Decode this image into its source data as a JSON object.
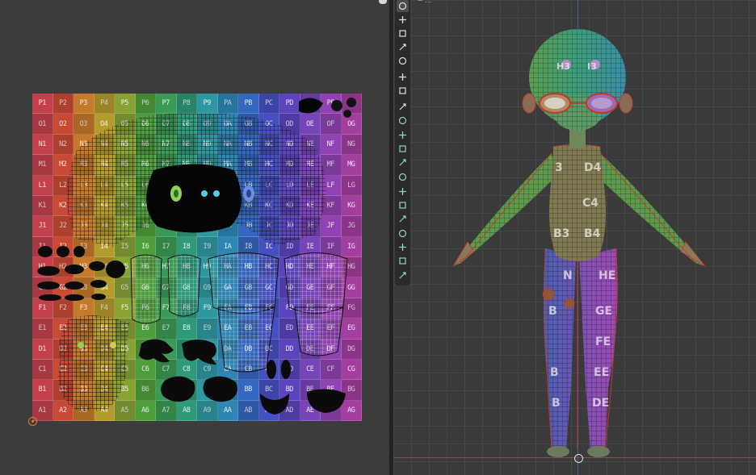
{
  "viewport": {
    "title": "~ …"
  },
  "uv_grid": {
    "rows": [
      [
        "P1",
        "P2",
        "P3",
        "P4",
        "P5",
        "P6",
        "P7",
        "P8",
        "P9",
        "PA",
        "PB",
        "PC",
        "PD",
        "PE",
        "PF",
        "PG"
      ],
      [
        "O1",
        "O2",
        "O3",
        "O4",
        "O5",
        "O6",
        "O7",
        "O8",
        "O9",
        "OA",
        "OB",
        "OC",
        "OD",
        "OE",
        "OF",
        "OG"
      ],
      [
        "N1",
        "N2",
        "N3",
        "N4",
        "N5",
        "N6",
        "N7",
        "N8",
        "N9",
        "NA",
        "NB",
        "NC",
        "ND",
        "NE",
        "NF",
        "NG"
      ],
      [
        "M1",
        "M2",
        "M3",
        "M4",
        "M5",
        "M6",
        "M7",
        "M8",
        "M9",
        "MA",
        "MB",
        "MC",
        "MD",
        "ME",
        "MF",
        "MG"
      ],
      [
        "L1",
        "L2",
        "L3",
        "L4",
        "L5",
        "L6",
        "L7",
        "L8",
        "L9",
        "LA",
        "LB",
        "LC",
        "LD",
        "LE",
        "LF",
        "LG"
      ],
      [
        "K1",
        "K2",
        "K3",
        "K4",
        "K5",
        "K6",
        "K7",
        "K8",
        "K9",
        "KA",
        "KB",
        "KC",
        "KD",
        "KE",
        "KF",
        "KG"
      ],
      [
        "J1",
        "J2",
        "J3",
        "J4",
        "J5",
        "J6",
        "J7",
        "J8",
        "J9",
        "JA",
        "JB",
        "JC",
        "JD",
        "JE",
        "JF",
        "JG"
      ],
      [
        "I1",
        "I2",
        "I3",
        "I4",
        "I5",
        "I6",
        "I7",
        "I8",
        "I9",
        "IA",
        "IB",
        "IC",
        "ID",
        "IE",
        "IF",
        "IG"
      ],
      [
        "H1",
        "H2",
        "H3",
        "H4",
        "H5",
        "H6",
        "H7",
        "H8",
        "H9",
        "HA",
        "HB",
        "HC",
        "HD",
        "HE",
        "HF",
        "HG"
      ],
      [
        "G1",
        "G2",
        "G3",
        "G4",
        "G5",
        "G6",
        "G7",
        "G8",
        "G9",
        "GA",
        "GB",
        "GC",
        "GD",
        "GE",
        "GF",
        "GG"
      ],
      [
        "F1",
        "F2",
        "F3",
        "F4",
        "F5",
        "F6",
        "F7",
        "F8",
        "F9",
        "FA",
        "FB",
        "FC",
        "FD",
        "FE",
        "FF",
        "FG"
      ],
      [
        "E1",
        "E2",
        "E3",
        "E4",
        "E5",
        "E6",
        "E7",
        "E8",
        "E9",
        "EA",
        "EB",
        "EC",
        "ED",
        "EE",
        "EF",
        "EG"
      ],
      [
        "D1",
        "D2",
        "D3",
        "D4",
        "D5",
        "D6",
        "D7",
        "D8",
        "D9",
        "DA",
        "DB",
        "DC",
        "DD",
        "DE",
        "DF",
        "DG"
      ],
      [
        "C1",
        "C2",
        "C3",
        "C4",
        "C5",
        "C6",
        "C7",
        "C8",
        "C9",
        "CA",
        "CB",
        "CC",
        "CD",
        "CE",
        "CF",
        "CG"
      ],
      [
        "B1",
        "B2",
        "B3",
        "B4",
        "B5",
        "B6",
        "B7",
        "B8",
        "B9",
        "BA",
        "BB",
        "BC",
        "BD",
        "BE",
        "BF",
        "BG"
      ],
      [
        "A1",
        "A2",
        "A3",
        "A4",
        "A5",
        "A6",
        "A7",
        "A8",
        "A9",
        "AA",
        "AB",
        "AC",
        "AD",
        "AE",
        "AF",
        "AG"
      ]
    ],
    "column_colors": [
      "#c2404c",
      "#c84a34",
      "#c47a2a",
      "#b59a2c",
      "#86a334",
      "#4f9e3c",
      "#3b9a55",
      "#2f9a7a",
      "#2e98a0",
      "#2f86b4",
      "#3467c0",
      "#4650c2",
      "#5c44bc",
      "#7844b8",
      "#9142b2",
      "#a33e9e"
    ]
  },
  "model_labels": {
    "head_left": "H3",
    "head_right": "I3",
    "torso_top_left": "3",
    "torso_top_right": "D4",
    "torso_mid": "C4",
    "torso_low_left": "B3",
    "torso_low_right": "B4",
    "leg_left_top": "N",
    "leg_right_top": "HE",
    "leg_left_2": "B",
    "leg_right_2": "GE",
    "leg_right_3": "FE",
    "leg_left_4": "B",
    "leg_right_4": "EE",
    "leg_left_5": "B",
    "leg_right_5": "DE"
  },
  "toolbar": {
    "tools": [
      {
        "name": "select-tool-icon"
      },
      {
        "name": "cursor-tool-icon"
      },
      {
        "name": "move-tool-icon"
      },
      {
        "name": "rotate-tool-icon"
      },
      {
        "name": "scale-tool-icon"
      },
      {
        "name": "transform-tool-icon"
      },
      {
        "name": "annotate-tool-icon"
      },
      {
        "name": "measure-tool-icon"
      },
      {
        "name": "add-cube-tool-icon"
      },
      {
        "name": "extrude-tool-icon"
      },
      {
        "name": "inset-tool-icon"
      },
      {
        "name": "bevel-tool-icon"
      },
      {
        "name": "loop-cut-tool-icon"
      },
      {
        "name": "knife-tool-icon"
      },
      {
        "name": "poly-build-tool-icon"
      },
      {
        "name": "spin-tool-icon"
      },
      {
        "name": "smooth-tool-icon"
      },
      {
        "name": "edge-slide-tool-icon"
      },
      {
        "name": "shrink-tool-icon"
      },
      {
        "name": "shear-tool-icon"
      },
      {
        "name": "rip-tool-icon"
      }
    ]
  }
}
